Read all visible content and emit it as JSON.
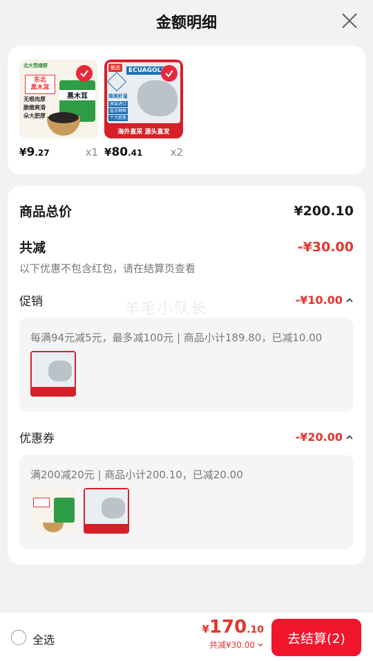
{
  "header": {
    "title": "金额明细"
  },
  "products": [
    {
      "name_lines": [
        "北大荒绿野",
        "东北",
        "黑木耳",
        "无根肉厚",
        "脆嫩爽滑",
        "朵大肥厚",
        "黑木耳"
      ],
      "price_currency": "¥",
      "price_int": "9",
      "price_dec": ".27",
      "qty": "x1"
    },
    {
      "name_lines": [
        "甄选",
        "南美虾皇",
        "ECUAGOLD",
        "原装进口",
        "盐冻鲜鲜",
        "个大肥美",
        "海外直采 源头直发"
      ],
      "price_currency": "¥",
      "price_int": "80",
      "price_dec": ".41",
      "qty": "x2"
    }
  ],
  "summary": {
    "total_label": "商品总价",
    "total_value": "¥200.10",
    "discount_label": "共减",
    "discount_value": "-¥30.00",
    "hint": "以下优惠不包含红包，请在结算页查看"
  },
  "promotion": {
    "label": "促销",
    "value": "-¥10.00",
    "detail": "每满94元减5元，最多减100元 | 商品小计189.80，已减10.00"
  },
  "coupon": {
    "label": "优惠券",
    "value": "-¥20.00",
    "detail": "满200减20元 | 商品小计200.10，已减20.00"
  },
  "watermark": "羊毛小队长",
  "footer": {
    "select_all": "全选",
    "total_currency": "¥",
    "total_int": "170",
    "total_dec": ".10",
    "discount_text": "共减¥30.00",
    "checkout_label": "去结算(2)"
  },
  "colors": {
    "accent_red": "#e5342d",
    "button_red": "#f0162b"
  }
}
